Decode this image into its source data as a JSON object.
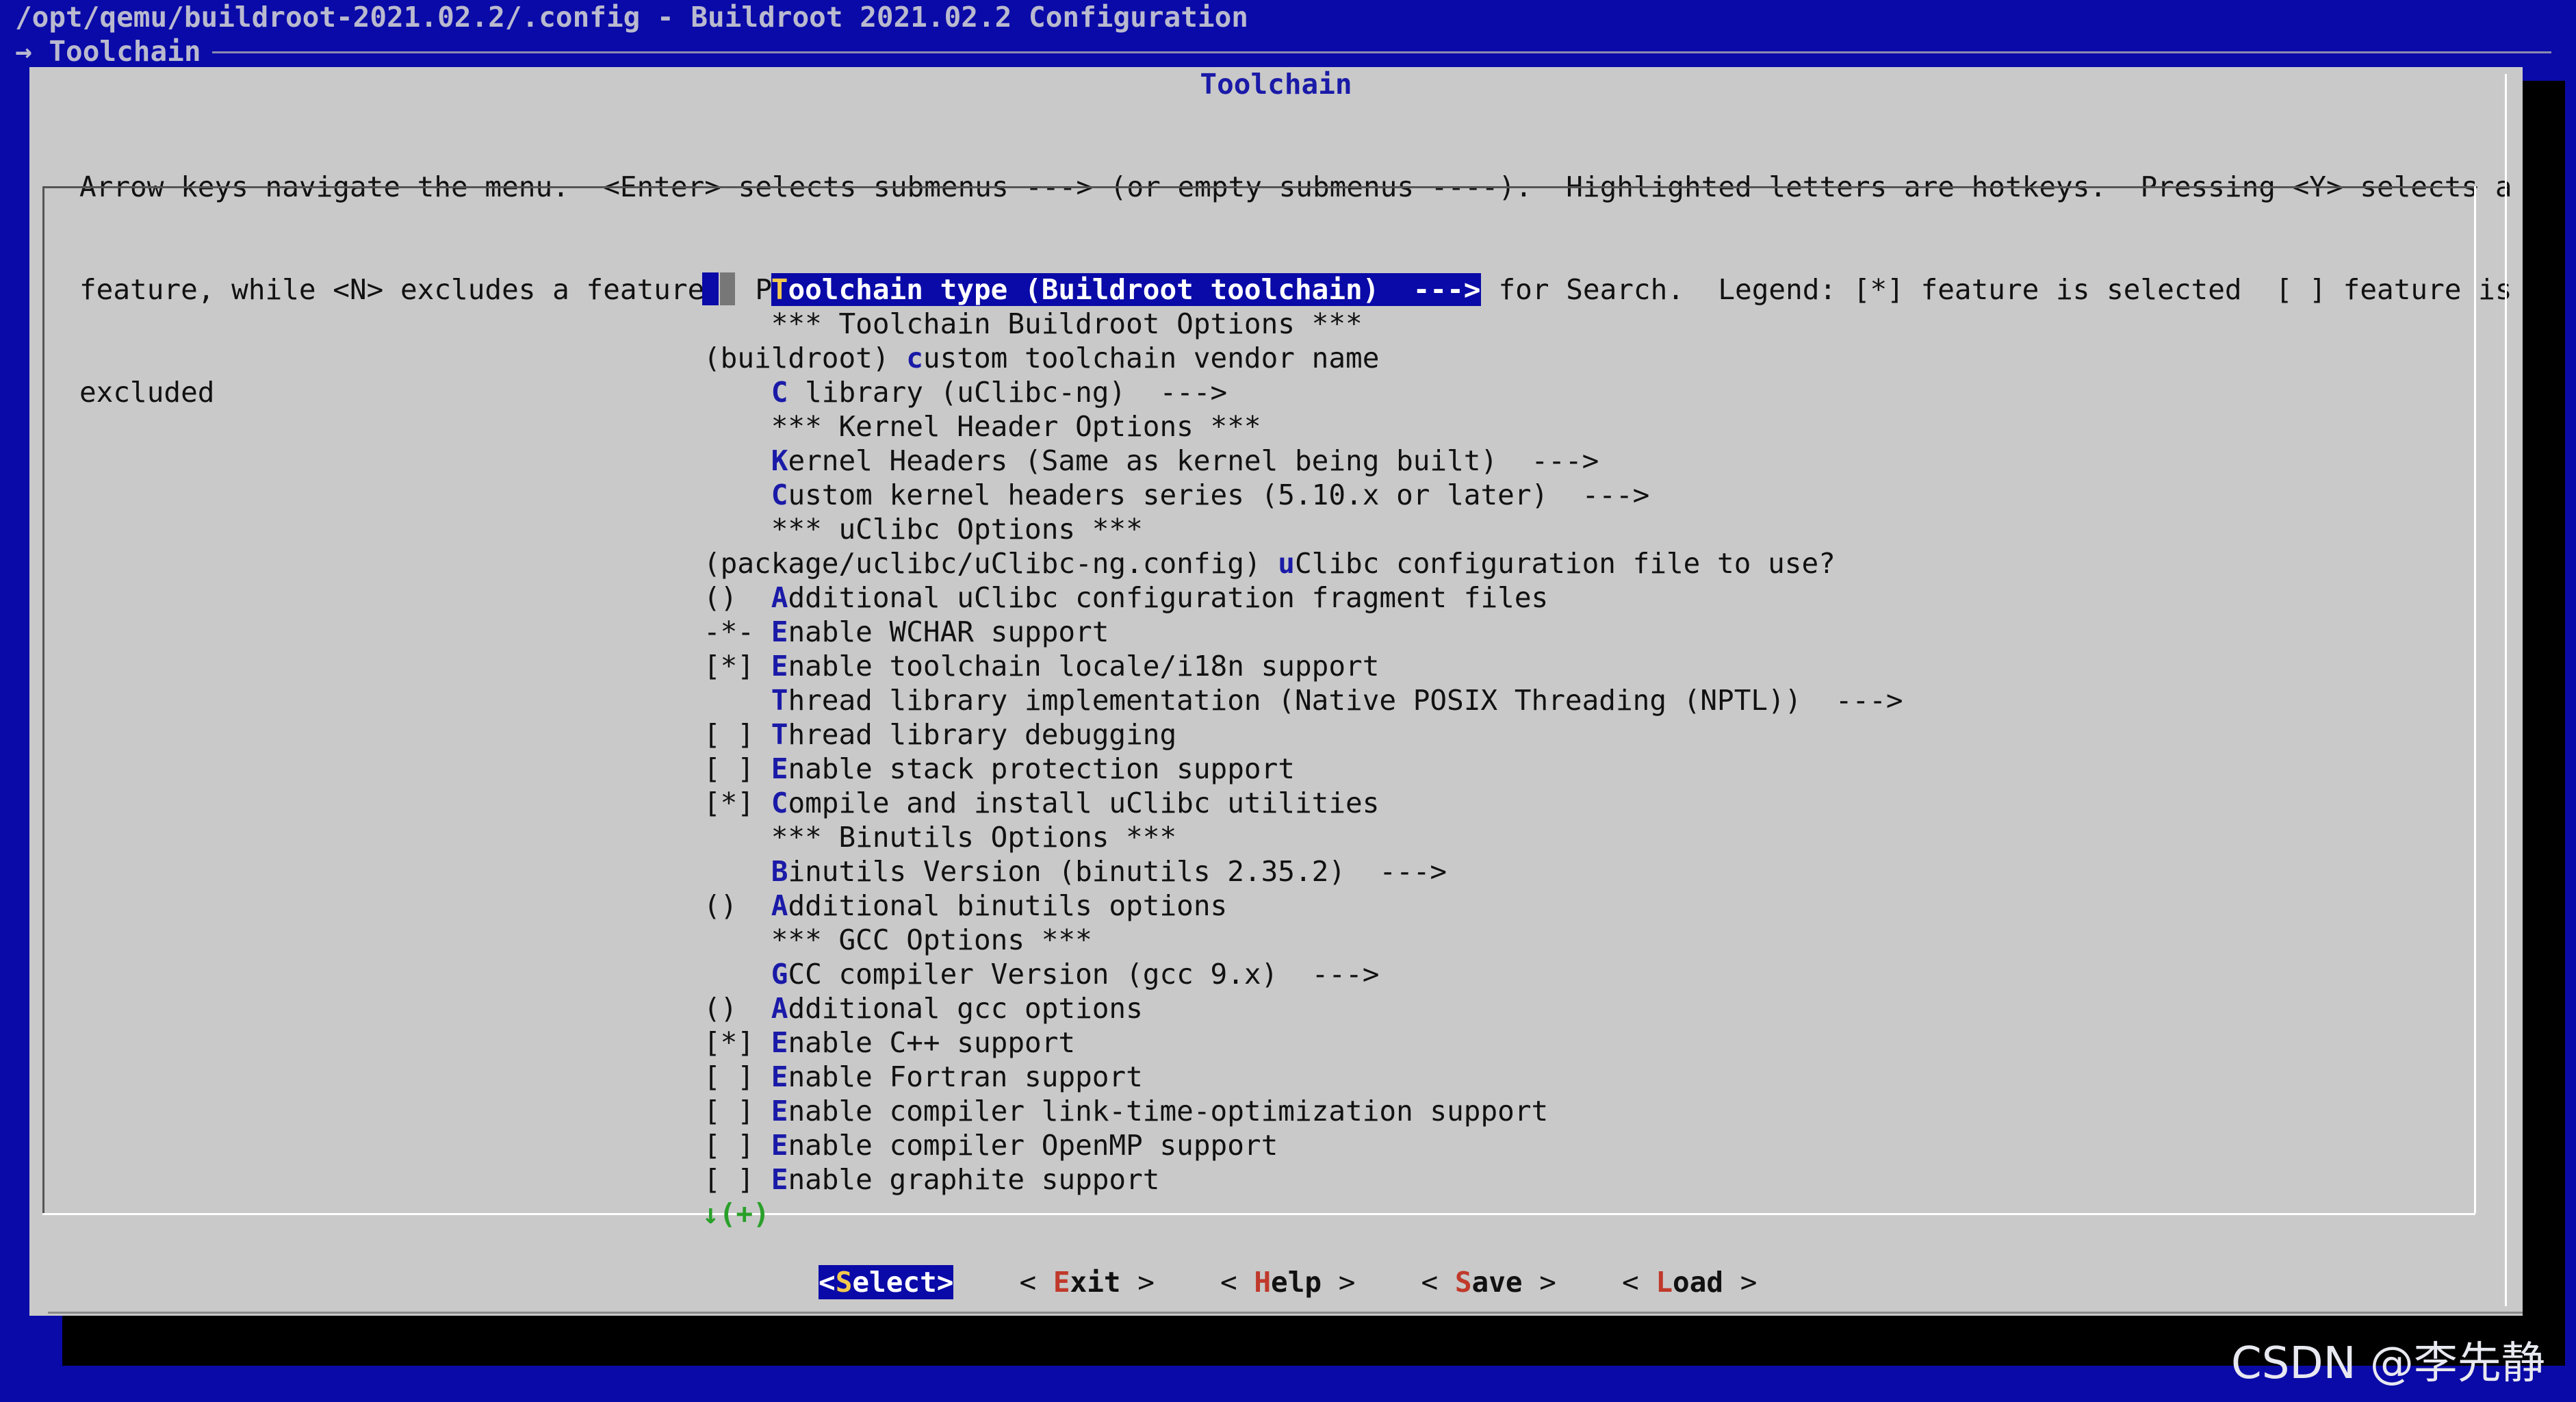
{
  "window": {
    "title": "/opt/qemu/buildroot-2021.02.2/.config - Buildroot 2021.02.2 Configuration",
    "breadcrumb": "→ Toolchain"
  },
  "dialog": {
    "title": "Toolchain",
    "help_lines": [
      "Arrow keys navigate the menu.  <Enter> selects submenus ---> (or empty submenus ----).  Highlighted letters are hotkeys.  Pressing <Y> selects a",
      "feature, while <N> excludes a feature.  Press <Esc><Esc> to exit, <?> for Help, </> for Search.  Legend: [*] feature is selected  [ ] feature is",
      "excluded"
    ]
  },
  "menu": {
    "items": [
      {
        "prefix": "    ",
        "hot": "T",
        "rest": "oolchain type (Buildroot toolchain)  --->"
      },
      {
        "prefix": "    ",
        "hot": "",
        "rest": "*** Toolchain Buildroot Options ***"
      },
      {
        "prefix": "(buildroot) ",
        "hot": "c",
        "rest": "ustom toolchain vendor name"
      },
      {
        "prefix": "    ",
        "hot": "C",
        "rest": " library (uClibc-ng)  --->"
      },
      {
        "prefix": "    ",
        "hot": "",
        "rest": "*** Kernel Header Options ***"
      },
      {
        "prefix": "    ",
        "hot": "K",
        "rest": "ernel Headers (Same as kernel being built)  --->"
      },
      {
        "prefix": "    ",
        "hot": "C",
        "rest": "ustom kernel headers series (5.10.x or later)  --->"
      },
      {
        "prefix": "    ",
        "hot": "",
        "rest": "*** uClibc Options ***"
      },
      {
        "prefix": "(package/uclibc/uClibc-ng.config) ",
        "hot": "u",
        "rest": "Clibc configuration file to use?"
      },
      {
        "prefix": "()  ",
        "hot": "A",
        "rest": "dditional uClibc configuration fragment files"
      },
      {
        "prefix": "-*- ",
        "hot": "E",
        "rest": "nable WCHAR support"
      },
      {
        "prefix": "[*] ",
        "hot": "E",
        "rest": "nable toolchain locale/i18n support"
      },
      {
        "prefix": "    ",
        "hot": "T",
        "rest": "hread library implementation (Native POSIX Threading (NPTL))  --->"
      },
      {
        "prefix": "[ ] ",
        "hot": "T",
        "rest": "hread library debugging"
      },
      {
        "prefix": "[ ] ",
        "hot": "E",
        "rest": "nable stack protection support"
      },
      {
        "prefix": "[*] ",
        "hot": "C",
        "rest": "ompile and install uClibc utilities"
      },
      {
        "prefix": "    ",
        "hot": "",
        "rest": "*** Binutils Options ***"
      },
      {
        "prefix": "    ",
        "hot": "B",
        "rest": "inutils Version (binutils 2.35.2)  --->"
      },
      {
        "prefix": "()  ",
        "hot": "A",
        "rest": "dditional binutils options"
      },
      {
        "prefix": "    ",
        "hot": "",
        "rest": "*** GCC Options ***"
      },
      {
        "prefix": "    ",
        "hot": "G",
        "rest": "CC compiler Version (gcc 9.x)  --->"
      },
      {
        "prefix": "()  ",
        "hot": "A",
        "rest": "dditional gcc options"
      },
      {
        "prefix": "[*] ",
        "hot": "E",
        "rest": "nable C++ support"
      },
      {
        "prefix": "[ ] ",
        "hot": "E",
        "rest": "nable Fortran support"
      },
      {
        "prefix": "[ ] ",
        "hot": "E",
        "rest": "nable compiler link-time-optimization support"
      },
      {
        "prefix": "[ ] ",
        "hot": "E",
        "rest": "nable compiler OpenMP support"
      },
      {
        "prefix": "[ ] ",
        "hot": "E",
        "rest": "nable graphite support"
      }
    ],
    "selected_index": 0,
    "more_indicator": "↓(+)"
  },
  "buttons": [
    {
      "pre": "<",
      "hot": "S",
      "rest": "elect",
      "post": ">",
      "active": true
    },
    {
      "pre": "< ",
      "hot": "E",
      "rest": "xit",
      "post": " >",
      "active": false
    },
    {
      "pre": "< ",
      "hot": "H",
      "rest": "elp",
      "post": " >",
      "active": false
    },
    {
      "pre": "< ",
      "hot": "S",
      "rest": "ave",
      "post": " >",
      "active": false
    },
    {
      "pre": "< ",
      "hot": "L",
      "rest": "oad",
      "post": " >",
      "active": false
    }
  ],
  "watermark": "CSDN @李先静",
  "colors": {
    "terminal_bg": "#0a0aa8",
    "dialog_bg": "#c9c9c9",
    "hotkey": "#1a1aa8",
    "button_hotkey": "#c0392b",
    "more_indicator": "#2aa02a"
  }
}
